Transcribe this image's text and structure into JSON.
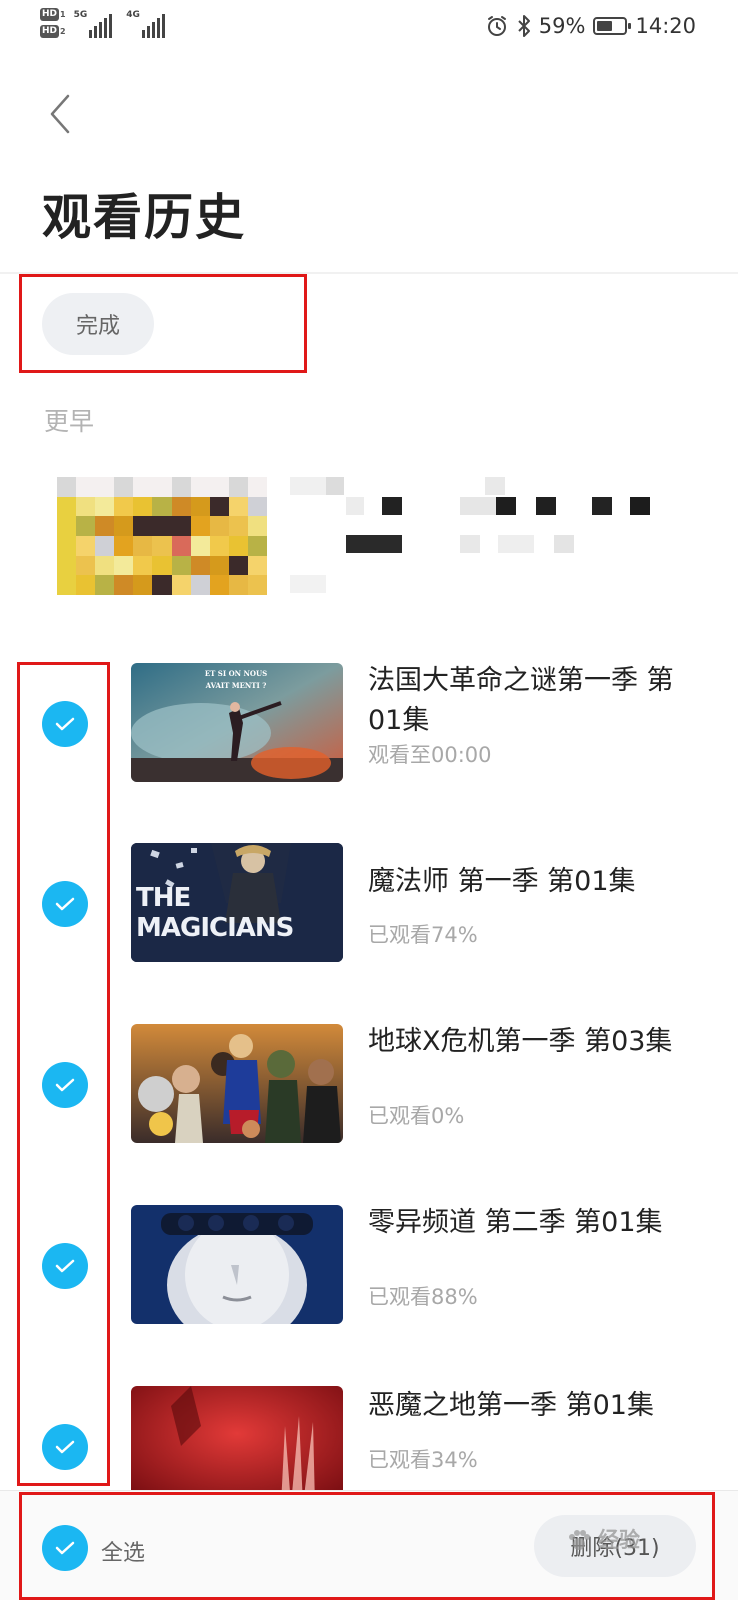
{
  "status_bar": {
    "hd1": "HD",
    "hd1_sub": "1",
    "hd2": "HD",
    "hd2_sub": "2",
    "net1": "5G",
    "net2": "4G",
    "battery_percent": "59%",
    "battery_level": 0.59,
    "time": "14:20",
    "icons": [
      "alarm-icon",
      "bluetooth-icon",
      "battery-icon"
    ]
  },
  "header": {
    "back_icon": "chevron-left-icon",
    "title": "观看历史"
  },
  "toolbar": {
    "done_label": "完成"
  },
  "section": {
    "label": "更早"
  },
  "items": [
    {
      "title": "法国大革命之谜第一季 第01集",
      "subtitle": "观看至00:00",
      "checked": true,
      "thumb_text": "ET SI ON NOUS AVAIT MENTI ?"
    },
    {
      "title": "魔法师 第一季 第01集",
      "subtitle": "已观看74%",
      "checked": true,
      "thumb_text": "THE MAGICIANS"
    },
    {
      "title": "地球X危机第一季 第03集",
      "subtitle": "已观看0%",
      "checked": true
    },
    {
      "title": "零异频道  第二季 第01集",
      "subtitle": "已观看88%",
      "checked": true
    },
    {
      "title": "恶魔之地第一季 第01集",
      "subtitle": "已观看34%",
      "checked": true
    }
  ],
  "bottom_bar": {
    "select_all_label": "全选",
    "delete_label": "删除(31)"
  },
  "watermark": "经验",
  "colors": {
    "accent": "#1bb7f2",
    "highlight": "#e01818",
    "muted": "#a8a8a8"
  }
}
